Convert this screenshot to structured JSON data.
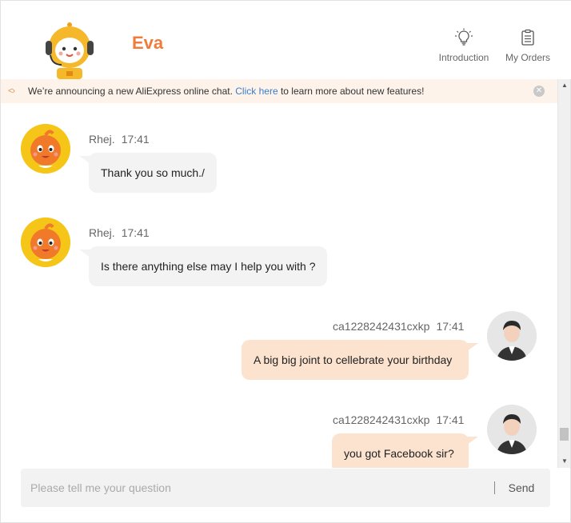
{
  "header": {
    "agent_name": "Eva",
    "introduction_label": "Introduction",
    "orders_label": "My Orders"
  },
  "announcement": {
    "text_before": "We’re announcing a new AliExpress online chat. ",
    "link_text": "Click here",
    "text_after": " to learn more about new features!",
    "close_icon": "close-icon"
  },
  "messages": [
    {
      "sender": "Rhej.",
      "time": "17:41",
      "text": "Thank you so much./",
      "side": "agent"
    },
    {
      "sender": "Rhej.",
      "time": "17:41",
      "text": "Is there anything else may I help you with ?",
      "side": "agent"
    },
    {
      "sender": "ca1228242431cxkp",
      "time": "17:41",
      "text": "A big big joint to cellebrate your birthday",
      "side": "user"
    },
    {
      "sender": "ca1228242431cxkp",
      "time": "17:41",
      "text": "you got Facebook sir?",
      "side": "user"
    }
  ],
  "composer": {
    "placeholder": "Please tell me your question",
    "value": "",
    "send_label": "Send"
  },
  "colors": {
    "accent": "#f07c3b",
    "agent_bubble": "#f3f3f3",
    "user_bubble": "#fbe3cf",
    "announcement_bg": "#fdf3ea",
    "link": "#3a7ec9"
  }
}
